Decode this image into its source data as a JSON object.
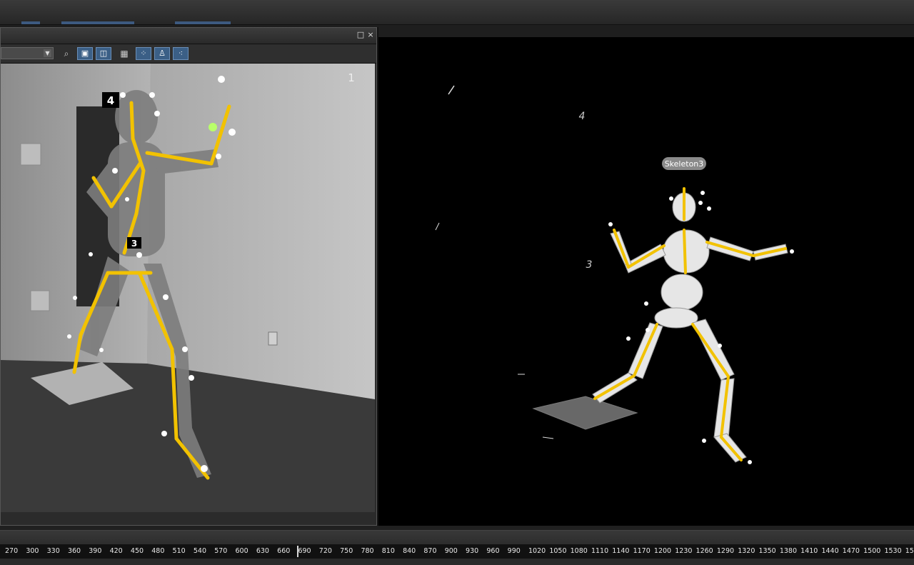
{
  "topbar": {
    "accent": "#3d5a80"
  },
  "camera_panel": {
    "camera_number": "1",
    "marker_labels": [
      "4",
      "3"
    ],
    "window_buttons": {
      "maximize": "□",
      "close": "×"
    },
    "toolbar_icons": [
      "zoom-icon",
      "camera-lock-icon",
      "split-view-icon",
      "grid-icon",
      "marker-filter-icon",
      "skeleton-filter-icon",
      "rigid-body-filter-icon"
    ]
  },
  "viewport": {
    "skeleton_label": "Skeleton3",
    "labels": [
      "4",
      "3"
    ],
    "bone_color": "#f2c200"
  },
  "timeline": {
    "ticks": [
      "270",
      "300",
      "330",
      "360",
      "390",
      "420",
      "450",
      "480",
      "510",
      "540",
      "570",
      "600",
      "630",
      "660",
      "690",
      "720",
      "750",
      "780",
      "810",
      "840",
      "870",
      "900",
      "930",
      "960",
      "990",
      "1020",
      "1050",
      "1080",
      "1110",
      "1140",
      "1170",
      "1200",
      "1230",
      "1260",
      "1290",
      "1320",
      "1350",
      "1380",
      "1410",
      "1440",
      "1470",
      "1500",
      "1530",
      "15"
    ],
    "current_frame": "690"
  }
}
